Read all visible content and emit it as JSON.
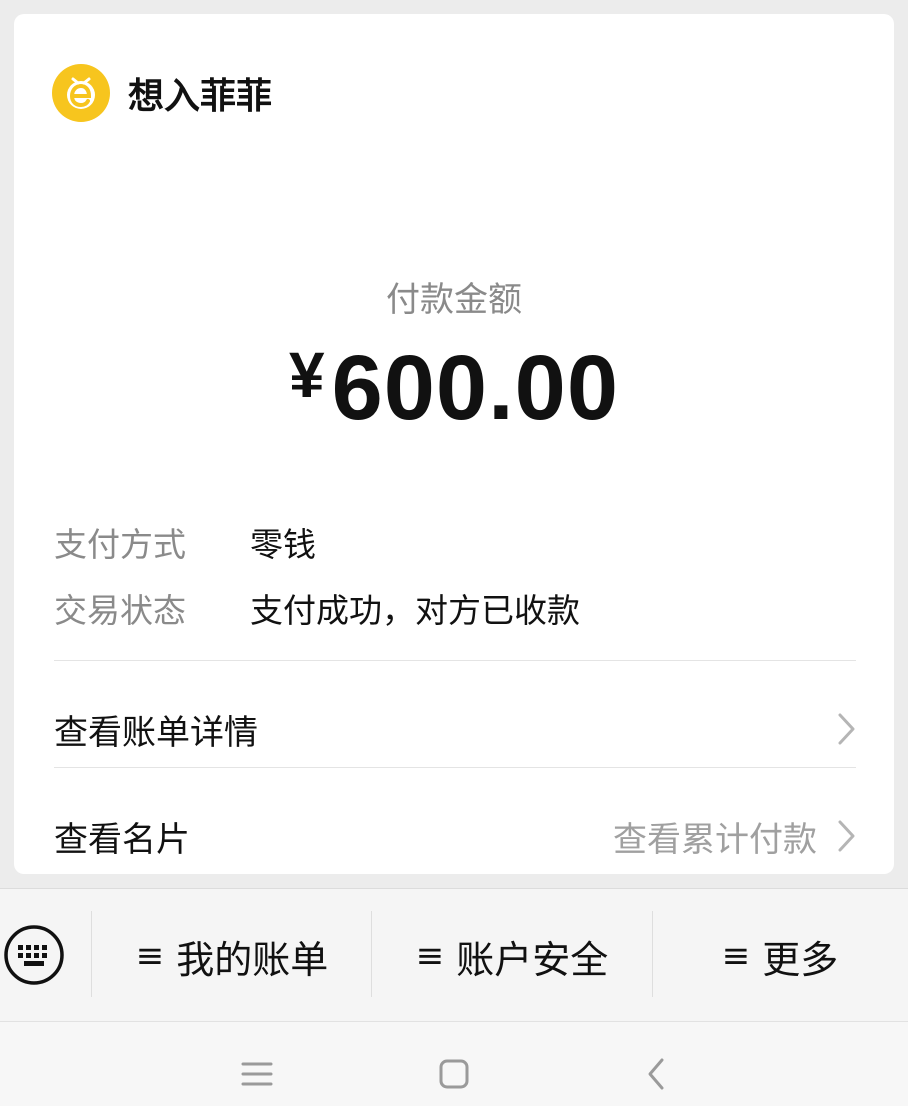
{
  "merchant": {
    "name": "想入菲菲",
    "icon": "smiley-e-logo-icon"
  },
  "payment": {
    "amount_label": "付款金额",
    "currency_symbol": "¥",
    "amount": "600.00"
  },
  "details": [
    {
      "key": "支付方式",
      "value": "零钱"
    },
    {
      "key": "交易状态",
      "value": "支付成功，对方已收款"
    }
  ],
  "links": {
    "bill_details": "查看账单详情",
    "view_card": "查看名片",
    "cumulative_payments": "查看累计付款"
  },
  "bottom_menu": {
    "icon": "keyboard-icon",
    "items": [
      {
        "label": "我的账单",
        "prefix": "≡"
      },
      {
        "label": "账户安全",
        "prefix": "≡"
      },
      {
        "label": "更多",
        "prefix": "≡"
      }
    ]
  },
  "nav_icons": [
    "menu-icon",
    "home-square-icon",
    "back-chevron-icon"
  ],
  "colors": {
    "avatar_bg": "#f7c51e",
    "secondary_text": "#8a8a8a"
  }
}
